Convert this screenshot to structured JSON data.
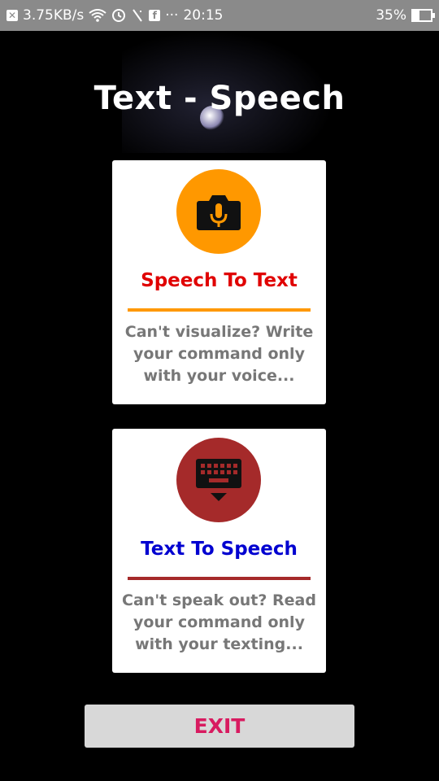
{
  "status_bar": {
    "network_speed": "3.75KB/s",
    "fb_icon_text": "f",
    "more": "···",
    "time": "20:15",
    "battery": "35%",
    "battery_fraction": 0.35
  },
  "app": {
    "title": "Text - Speech"
  },
  "cards": [
    {
      "title": "Speech To Text",
      "description": "Can't visualize? Write your command only with your voice...",
      "icon": "camera-microphone-icon",
      "title_color": "#e00000",
      "accent_color": "#ff9800"
    },
    {
      "title": "Text To Speech",
      "description": "Can't speak out? Read your command only with your texting...",
      "icon": "keyboard-hide-icon",
      "title_color": "#0000d0",
      "accent_color": "#a52a2a"
    }
  ],
  "exit": {
    "label": "EXIT",
    "color": "#d81b60"
  }
}
